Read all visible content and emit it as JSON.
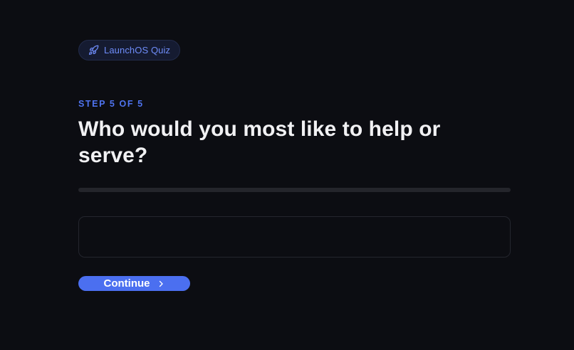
{
  "badge": {
    "label": "LaunchOS Quiz",
    "icon": "rocket-icon"
  },
  "step": {
    "label": "STEP 5 OF 5",
    "current": 5,
    "total": 5
  },
  "question": {
    "text": "Who would you most like to help or serve?"
  },
  "answer": {
    "value": "",
    "placeholder": ""
  },
  "continue_button": {
    "label": "Continue",
    "icon": "chevron-right-icon"
  },
  "colors": {
    "background": "#0c0d12",
    "accent": "#4b6ff0",
    "badge_text": "#6f8dfa",
    "heading": "#f1f1f3",
    "track": "#24252b"
  }
}
